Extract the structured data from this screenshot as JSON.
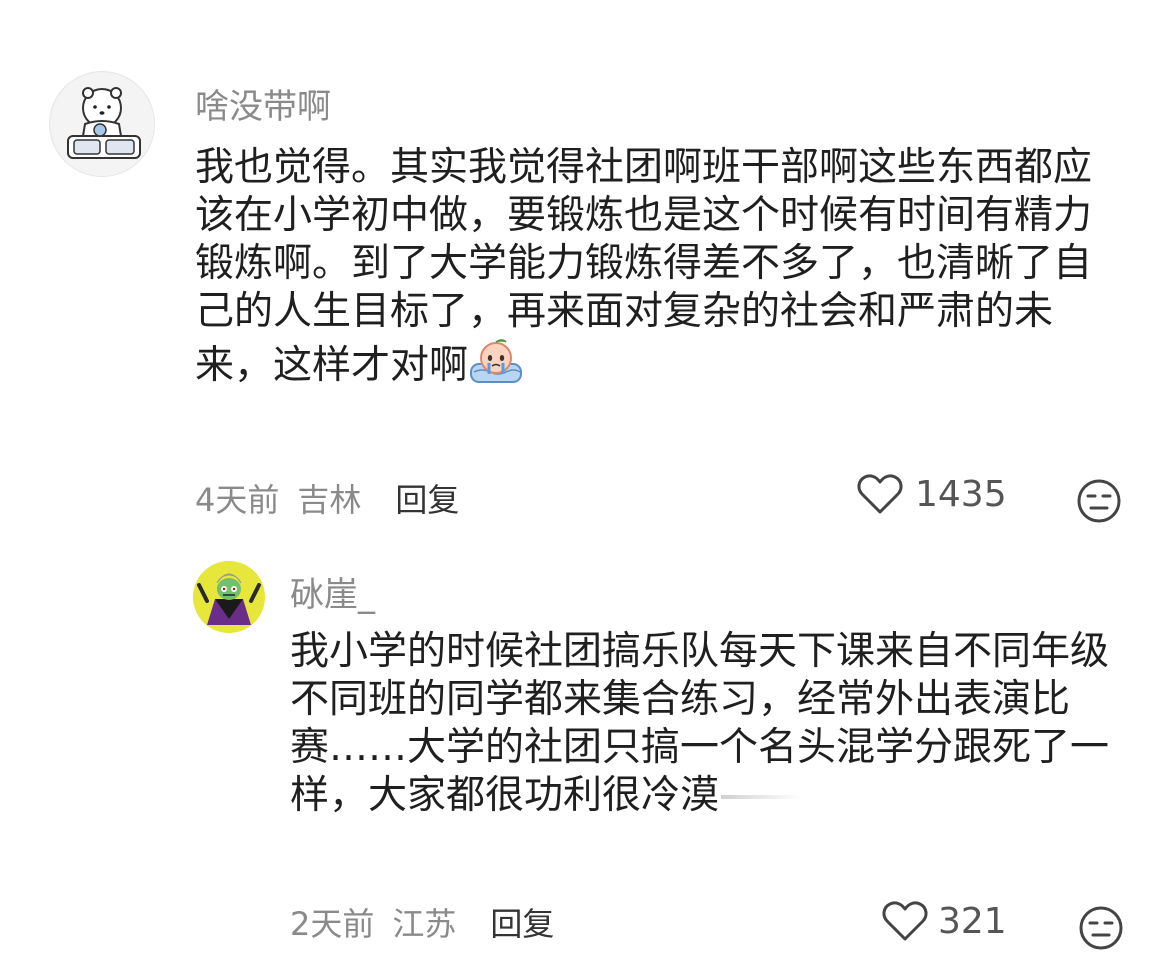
{
  "comments": [
    {
      "username": "啥没带啊",
      "text": "我也觉得。其实我觉得社团啊班干部啊这些东西都应该在小学初中做，要锻炼也是这个时候有时间有精力锻炼啊。到了大学能力锻炼得差不多了，也清晰了自己的人生目标了，再来面对复杂的社会和严肃的未来，这样才对啊",
      "emoji": "crying-peach-emoji",
      "time": "4天前",
      "location": "吉林",
      "reply_label": "回复",
      "likes": "1435",
      "avatar_icon": "white-bear-avatar"
    },
    {
      "username": "砅崖_",
      "text": "我小学的时候社团搞乐队每天下课来自不同年级不同班的同学都来集合练习，经常外出表演比赛……大学的社团只搞一个名头混学分跟死了一样，大家都很功利很冷漠",
      "time": "2天前",
      "location": "江苏",
      "reply_label": "回复",
      "likes": "321",
      "avatar_icon": "cartoon-character-avatar"
    }
  ],
  "colors": {
    "meta_text": "#8a8a8a",
    "body_text": "#1f1f1f",
    "avatar2_bg": "#e7e63a"
  }
}
